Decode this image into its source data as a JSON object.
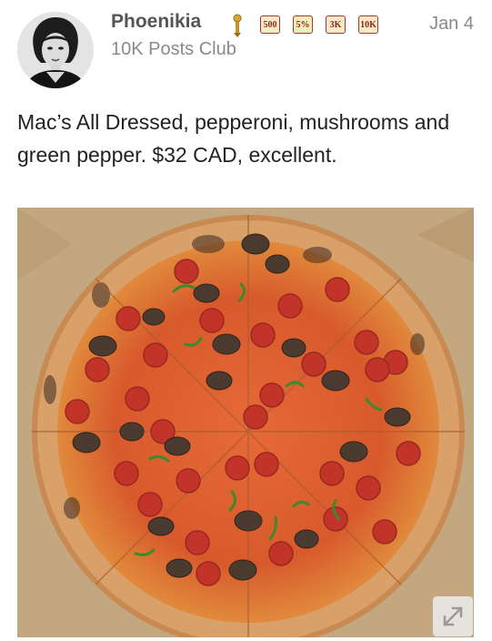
{
  "post": {
    "author": {
      "username": "Phoenikia",
      "user_title": "10K Posts Club",
      "avatar_icon": "avatar-portrait-icon"
    },
    "badges": [
      {
        "label": "500",
        "icon": "badge-500-icon"
      },
      {
        "label": "5%",
        "icon": "badge-5-percent-icon"
      },
      {
        "label": "3K",
        "icon": "badge-3k-icon"
      },
      {
        "label": "10K",
        "icon": "badge-10k-icon"
      }
    ],
    "date": "Jan 4",
    "body": "Mac’s All Dressed, pepperoni, mushrooms and green pepper. $32 CAD, excellent.",
    "image": {
      "icon": "pizza-photo",
      "expand_icon": "expand-icon"
    }
  },
  "colors": {
    "username": "#555555",
    "meta": "#8a8a8a",
    "body_text": "#222222",
    "badge_border": "#9e3a32",
    "badge_fill": "#f6e9c5",
    "box_cardboard": "#c4a983",
    "crust": "#d8955a",
    "sauce": "#d95a2e",
    "pepperoni": "#c2342a",
    "mushroom": "#4a3a30",
    "green_pepper": "#3d8a2a"
  }
}
